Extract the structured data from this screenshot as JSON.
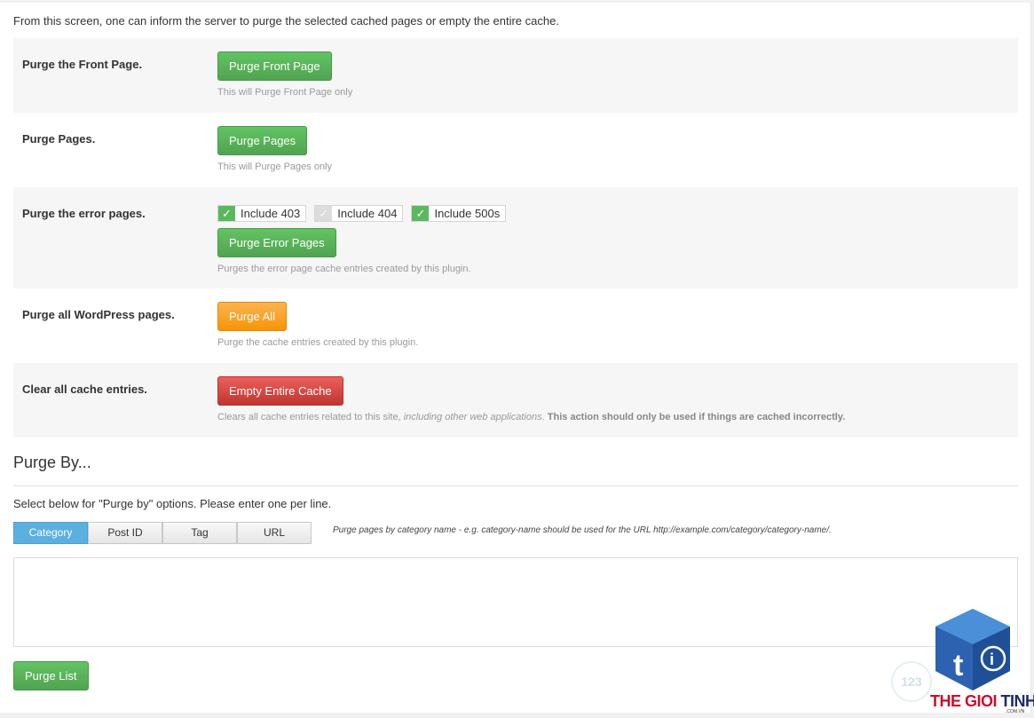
{
  "intro": "From this screen, one can inform the server to purge the selected cached pages or empty the entire cache.",
  "rows": {
    "front": {
      "label": "Purge the Front Page.",
      "button": "Purge Front Page",
      "desc": "This will Purge Front Page only"
    },
    "pages": {
      "label": "Purge Pages.",
      "button": "Purge Pages",
      "desc": "This will Purge Pages only"
    },
    "error": {
      "label": "Purge the error pages.",
      "checks": [
        {
          "label": "Include 403",
          "checked": true
        },
        {
          "label": "Include 404",
          "checked": false
        },
        {
          "label": "Include 500s",
          "checked": true
        }
      ],
      "button": "Purge Error Pages",
      "desc": "Purges the error page cache entries created by this plugin."
    },
    "all": {
      "label": "Purge all WordPress pages.",
      "button": "Purge All",
      "desc": "Purge the cache entries created by this plugin."
    },
    "clear": {
      "label": "Clear all cache entries.",
      "button": "Empty Entire Cache",
      "desc_prefix": "Clears all cache entries related to this site, ",
      "desc_italic": "including other web applications",
      "desc_mid": ". ",
      "desc_bold": "This action should only be used if things are cached incorrectly."
    }
  },
  "purge_by": {
    "title": "Purge By...",
    "desc": "Select below for \"Purge by\" options. Please enter one per line.",
    "tabs": [
      "Category",
      "Post ID",
      "Tag",
      "URL"
    ],
    "active_tab": "Category",
    "hint": "Purge pages by category name - e.g. category-name should be used for the URL http://example.com/category/category-name/.",
    "textarea_value": "",
    "submit": "Purge List"
  },
  "watermark": {
    "badge": "123",
    "brand_red": "THE GIOI",
    "brand_blue": "TINHOC",
    "domain": ".COM.VN"
  },
  "colors": {
    "green": "#5cb85c",
    "orange": "#f0ad4e",
    "red": "#d9534f",
    "tab_active": "#5bb0e0"
  }
}
